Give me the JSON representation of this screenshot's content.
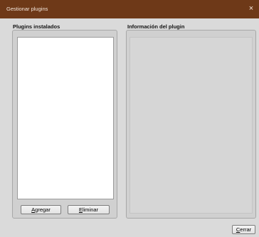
{
  "window": {
    "title": "Gestionar plugins",
    "close_glyph": "×"
  },
  "installed": {
    "label": "Plugins instalados",
    "items": [],
    "add_button": {
      "mnemonic": "A",
      "rest": "gregar"
    },
    "remove_button": {
      "mnemonic": "E",
      "rest": "liminar"
    }
  },
  "info": {
    "label": "Información del plugin",
    "content": ""
  },
  "footer": {
    "close_button": {
      "mnemonic": "C",
      "rest": "errar"
    }
  },
  "colors": {
    "titlebar": "#6e3918",
    "window_bg": "#dadada"
  }
}
